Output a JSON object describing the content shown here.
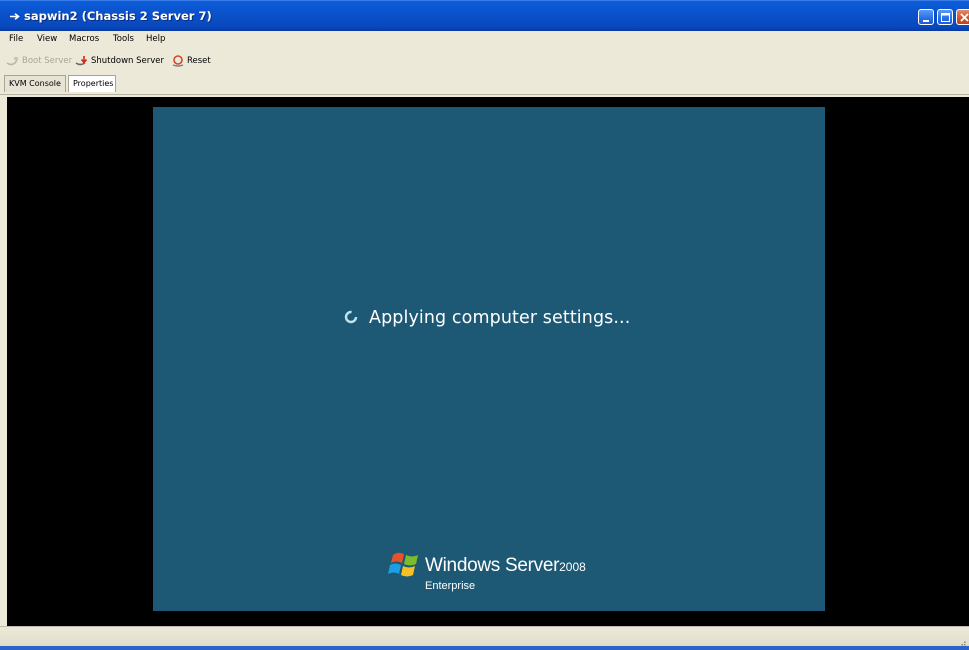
{
  "window": {
    "title": "sapwin2 (Chassis 2 Server 7)",
    "icon": "app-arrow-icon",
    "controls": [
      "minimize-icon",
      "maximize-icon",
      "close-icon"
    ]
  },
  "menu": {
    "items": [
      "File",
      "View",
      "Macros",
      "Tools",
      "Help"
    ]
  },
  "toolbar": {
    "boot_label": "Boot Server",
    "shutdown_label": "Shutdown Server",
    "reset_label": "Reset"
  },
  "tabs": [
    {
      "label": "KVM Console",
      "selected": true
    },
    {
      "label": "Properties",
      "selected": false
    }
  ],
  "console": {
    "status_text": "Applying computer settings...",
    "brand_name": "Windows Server",
    "brand_version": "2008",
    "brand_edition": "Enterprise",
    "screen_color": "#1d5975",
    "background_color": "#000000"
  },
  "colors": {
    "titlebar": "#0a50c8",
    "chrome": "#ece9d8"
  }
}
